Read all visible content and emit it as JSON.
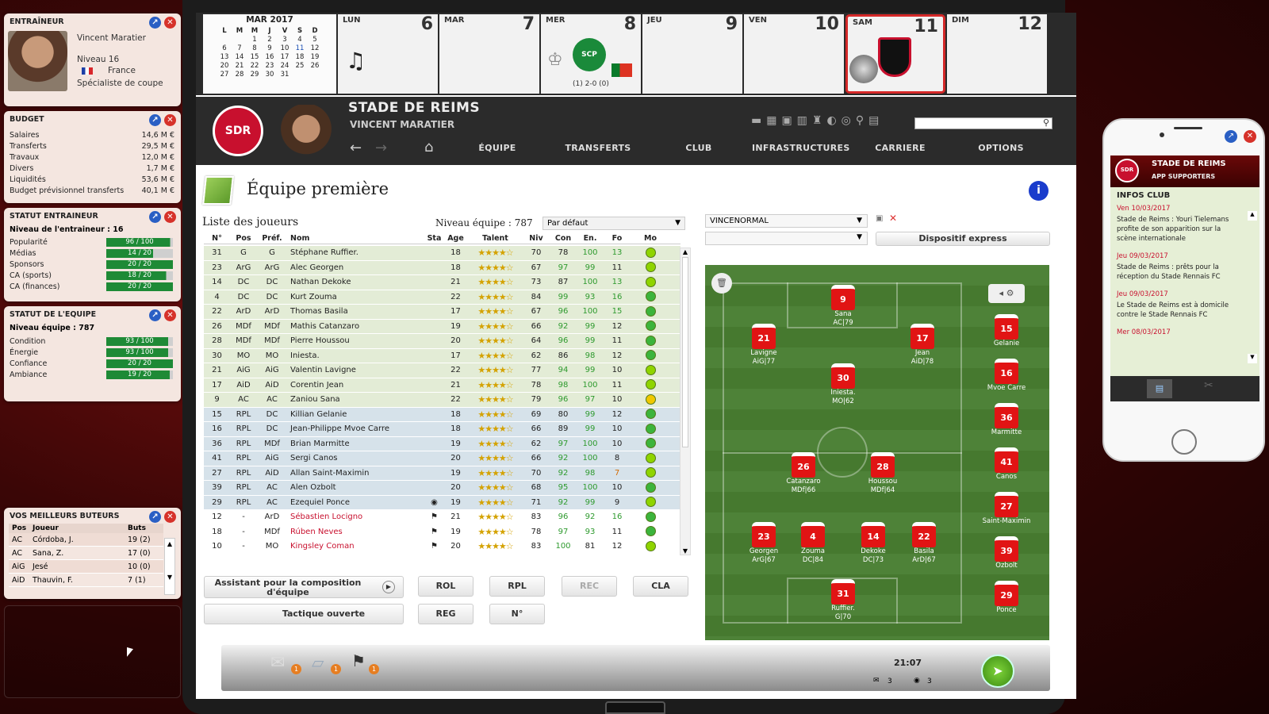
{
  "coach": {
    "title": "ENTRAÎNEUR",
    "name": "Vincent Maratier",
    "level": "Niveau 16",
    "country": "France",
    "spec": "Spécialiste de coupe"
  },
  "budget": {
    "title": "BUDGET",
    "rows": [
      {
        "k": "Salaires",
        "v": "14,6 M €"
      },
      {
        "k": "Transferts",
        "v": "29,5 M €"
      },
      {
        "k": "Travaux",
        "v": "12,0 M €"
      },
      {
        "k": "Divers",
        "v": "1,7 M €"
      },
      {
        "k": "Liquidités",
        "v": "53,6 M €"
      },
      {
        "k": "Budget prévisionnel transferts",
        "v": "40,1 M €"
      }
    ]
  },
  "coach_status": {
    "title": "STATUT ENTRAINEUR",
    "level": "Niveau de l'entraineur : 16",
    "rows": [
      {
        "k": "Popularité",
        "v": "96 / 100",
        "f": 0.96
      },
      {
        "k": "Médias",
        "v": "14 / 20",
        "f": 0.7
      },
      {
        "k": "Sponsors",
        "v": "20 / 20",
        "f": 1
      },
      {
        "k": "CA (sports)",
        "v": "18 / 20",
        "f": 0.9
      },
      {
        "k": "CA (finances)",
        "v": "20 / 20",
        "f": 1
      }
    ]
  },
  "team_status": {
    "title": "STATUT DE L'EQUIPE",
    "level": "Niveau équipe : 787",
    "rows": [
      {
        "k": "Condition",
        "v": "93 / 100",
        "f": 0.93
      },
      {
        "k": "Énergie",
        "v": "93 / 100",
        "f": 0.93
      },
      {
        "k": "Confiance",
        "v": "20 / 20",
        "f": 1
      },
      {
        "k": "Ambiance",
        "v": "19 / 20",
        "f": 0.95
      }
    ]
  },
  "scorers": {
    "title": "VOS MEILLEURS BUTEURS",
    "h_pos": "Pos",
    "h_player": "Joueur",
    "h_goals": "Buts",
    "rows": [
      {
        "p": "AC",
        "n": "Córdoba, J.",
        "g": "19 (2)"
      },
      {
        "p": "AC",
        "n": "Sana, Z.",
        "g": "17 (0)"
      },
      {
        "p": "AiG",
        "n": "Jesé",
        "g": "10 (0)"
      },
      {
        "p": "AiD",
        "n": "Thauvin, F.",
        "g": "7 (1)"
      }
    ]
  },
  "calendar": {
    "month": "MAR 2017",
    "dow": [
      "L",
      "M",
      "M",
      "J",
      "V",
      "S",
      "D"
    ],
    "weeks": [
      [
        "",
        "",
        "1",
        "2",
        "3",
        "4",
        "5"
      ],
      [
        "6",
        "7",
        "8",
        "9",
        "10",
        "11",
        "12"
      ],
      [
        "13",
        "14",
        "15",
        "16",
        "17",
        "18",
        "19"
      ],
      [
        "20",
        "21",
        "22",
        "23",
        "24",
        "25",
        "26"
      ],
      [
        "27",
        "28",
        "29",
        "30",
        "31",
        "",
        ""
      ]
    ],
    "days": [
      {
        "n": "LUN",
        "d": "6"
      },
      {
        "n": "MAR",
        "d": "7"
      },
      {
        "n": "MER",
        "d": "8"
      },
      {
        "n": "JEU",
        "d": "9"
      },
      {
        "n": "VEN",
        "d": "10"
      },
      {
        "n": "SAM",
        "d": "11"
      },
      {
        "n": "DIM",
        "d": "12"
      }
    ],
    "match_mer": "(1) 2-0 (0)",
    "scp": "SCP"
  },
  "header": {
    "club": "STADE DE REIMS",
    "coach": "VINCENT MARATIER",
    "crest": "SDR",
    "nav": [
      "ÉQUIPE",
      "TRANSFERTS",
      "CLUB",
      "INFRASTRUCTURES",
      "CARRIERE",
      "OPTIONS"
    ]
  },
  "page": {
    "title": "Équipe première",
    "list_title": "Liste des joueurs",
    "team_level": "Niveau équipe : 787",
    "sort": "Par défaut",
    "cols": [
      "N°",
      "Pos",
      "Préf.",
      "Nom",
      "Sta",
      "Age",
      "Talent",
      "Niv",
      "Con",
      "En.",
      "Fo",
      "Mo"
    ]
  },
  "players": [
    {
      "n": "31",
      "pos": "G",
      "pref": "G",
      "name": "Stéphane Ruffier.",
      "age": "18",
      "t": "★★★★☆",
      "niv": "70",
      "con": "78",
      "en": "100",
      "fo": "13",
      "c": "g",
      "mo": "#8fd400"
    },
    {
      "n": "23",
      "pos": "ArG",
      "pref": "ArG",
      "name": "Alec Georgen",
      "age": "18",
      "t": "★★★★☆",
      "niv": "67",
      "con": "97",
      "en": "99",
      "fo": "11",
      "c": "g",
      "mo": "#8fd400"
    },
    {
      "n": "14",
      "pos": "DC",
      "pref": "DC",
      "name": "Nathan Dekoke",
      "age": "21",
      "t": "★★★★☆",
      "niv": "73",
      "con": "87",
      "en": "100",
      "fo": "13",
      "c": "g",
      "mo": "#8fd400"
    },
    {
      "n": "4",
      "pos": "DC",
      "pref": "DC",
      "name": "Kurt Zouma",
      "age": "22",
      "t": "★★★★☆",
      "niv": "84",
      "con": "99",
      "en": "93",
      "fo": "16",
      "c": "g",
      "mo": "#3cb43c"
    },
    {
      "n": "22",
      "pos": "ArD",
      "pref": "ArD",
      "name": "Thomas Basila",
      "age": "17",
      "t": "★★★★☆",
      "niv": "67",
      "con": "96",
      "en": "100",
      "fo": "15",
      "c": "g",
      "mo": "#3cb43c"
    },
    {
      "n": "26",
      "pos": "MDf",
      "pref": "MDf",
      "name": "Mathis Catanzaro",
      "age": "19",
      "t": "★★★★☆",
      "niv": "66",
      "con": "92",
      "en": "99",
      "fo": "12",
      "c": "g",
      "mo": "#3cb43c"
    },
    {
      "n": "28",
      "pos": "MDf",
      "pref": "MDf",
      "name": "Pierre Houssou",
      "age": "20",
      "t": "★★★★☆",
      "niv": "64",
      "con": "96",
      "en": "99",
      "fo": "11",
      "c": "g",
      "mo": "#3cb43c"
    },
    {
      "n": "30",
      "pos": "MO",
      "pref": "MO",
      "name": "Iniesta.",
      "age": "17",
      "t": "★★★★☆",
      "niv": "62",
      "con": "86",
      "en": "98",
      "fo": "12",
      "c": "g",
      "mo": "#3cb43c"
    },
    {
      "n": "21",
      "pos": "AiG",
      "pref": "AiG",
      "name": "Valentin Lavigne",
      "age": "22",
      "t": "★★★★☆",
      "niv": "77",
      "con": "94",
      "en": "99",
      "fo": "10",
      "c": "g",
      "mo": "#8fd400"
    },
    {
      "n": "17",
      "pos": "AiD",
      "pref": "AiD",
      "name": "Corentin Jean",
      "age": "21",
      "t": "★★★★☆",
      "niv": "78",
      "con": "98",
      "en": "100",
      "fo": "11",
      "c": "g",
      "mo": "#8fd400"
    },
    {
      "n": "9",
      "pos": "AC",
      "pref": "AC",
      "name": "Zaniou Sana",
      "age": "22",
      "t": "★★★★☆",
      "niv": "79",
      "con": "96",
      "en": "97",
      "fo": "10",
      "c": "g",
      "mo": "#f0c800"
    },
    {
      "n": "15",
      "pos": "RPL",
      "pref": "DC",
      "name": "Killian Gelanie",
      "age": "18",
      "t": "★★★★☆",
      "niv": "69",
      "con": "80",
      "en": "99",
      "fo": "12",
      "c": "b",
      "mo": "#3cb43c"
    },
    {
      "n": "16",
      "pos": "RPL",
      "pref": "DC",
      "name": "Jean-Philippe Mvoe Carre",
      "age": "18",
      "t": "★★★★☆",
      "niv": "66",
      "con": "89",
      "en": "99",
      "fo": "10",
      "c": "b",
      "mo": "#3cb43c"
    },
    {
      "n": "36",
      "pos": "RPL",
      "pref": "MDf",
      "name": "Brian Marmitte",
      "age": "19",
      "t": "★★★★☆",
      "niv": "62",
      "con": "97",
      "en": "100",
      "fo": "10",
      "c": "b",
      "mo": "#3cb43c"
    },
    {
      "n": "41",
      "pos": "RPL",
      "pref": "AiG",
      "name": "Sergi Canos",
      "age": "20",
      "t": "★★★★☆",
      "niv": "66",
      "con": "92",
      "en": "100",
      "fo": "8",
      "c": "b",
      "mo": "#8fd400"
    },
    {
      "n": "27",
      "pos": "RPL",
      "pref": "AiD",
      "name": "Allan Saint-Maximin",
      "age": "19",
      "t": "★★★★☆",
      "niv": "70",
      "con": "92",
      "en": "98",
      "fo": "7",
      "c": "b",
      "mo": "#8fd400"
    },
    {
      "n": "39",
      "pos": "RPL",
      "pref": "AC",
      "name": "Alen Ozbolt",
      "age": "20",
      "t": "★★★★☆",
      "niv": "68",
      "con": "95",
      "en": "100",
      "fo": "10",
      "c": "b",
      "mo": "#3cb43c"
    },
    {
      "n": "29",
      "pos": "RPL",
      "pref": "AC",
      "name": "Ezequiel Ponce",
      "age": "19",
      "t": "★★★★☆",
      "niv": "71",
      "con": "92",
      "en": "99",
      "fo": "9",
      "c": "b",
      "mo": "#8fd400"
    },
    {
      "n": "12",
      "pos": "-",
      "pref": "ArD",
      "name": "Sébastien Locigno",
      "age": "21",
      "t": "★★★★☆",
      "niv": "83",
      "con": "96",
      "en": "92",
      "fo": "16",
      "c": "w",
      "mo": "#3cb43c"
    },
    {
      "n": "18",
      "pos": "-",
      "pref": "MDf",
      "name": "Rúben Neves",
      "age": "19",
      "t": "★★★★☆",
      "niv": "78",
      "con": "97",
      "en": "93",
      "fo": "11",
      "c": "w",
      "mo": "#3cb43c"
    },
    {
      "n": "10",
      "pos": "-",
      "pref": "MO",
      "name": "Kingsley Coman",
      "age": "20",
      "t": "★★★★☆",
      "niv": "83",
      "con": "100",
      "en": "81",
      "fo": "12",
      "c": "w",
      "mo": "#8fd400"
    }
  ],
  "buttons": {
    "assistant": "Assistant pour la composition d'équipe",
    "tactic": "Tactique ouverte",
    "rol": "ROL",
    "rpl": "RPL",
    "rec": "REC",
    "cla": "CLA",
    "reg": "REG",
    "num": "N°"
  },
  "tactics": {
    "formation": "VINCENORMAL",
    "express": "Dispositif express"
  },
  "pitch": [
    {
      "n": "9",
      "name": "Sana",
      "role": "AC|79"
    },
    {
      "n": "21",
      "name": "Lavigne",
      "role": "AiG|77"
    },
    {
      "n": "17",
      "name": "Jean",
      "role": "AiD|78"
    },
    {
      "n": "30",
      "name": "Iniesta.",
      "role": "MO|62"
    },
    {
      "n": "26",
      "name": "Catanzaro",
      "role": "MDf|66"
    },
    {
      "n": "28",
      "name": "Houssou",
      "role": "MDf|64"
    },
    {
      "n": "23",
      "name": "Georgen",
      "role": "ArG|67"
    },
    {
      "n": "4",
      "name": "Zouma",
      "role": "DC|84"
    },
    {
      "n": "14",
      "name": "Dekoke",
      "role": "DC|73"
    },
    {
      "n": "22",
      "name": "Basila",
      "role": "ArD|67"
    },
    {
      "n": "31",
      "name": "Ruffier.",
      "role": "G|70"
    }
  ],
  "bench": [
    {
      "n": "15",
      "name": "Gelanie"
    },
    {
      "n": "16",
      "name": "Mvoe Carre"
    },
    {
      "n": "36",
      "name": "Marmitte"
    },
    {
      "n": "41",
      "name": "Canos"
    },
    {
      "n": "27",
      "name": "Saint-Maximin"
    },
    {
      "n": "39",
      "name": "Ozbolt"
    },
    {
      "n": "29",
      "name": "Ponce"
    }
  ],
  "phone": {
    "club": "STADE DE REIMS",
    "app": "APP SUPPORTERS",
    "section": "INFOS CLUB",
    "news": [
      {
        "d": "Ven 10/03/2017",
        "t": "Stade de Reims : Youri Tielemans profite de son apparition sur la scène internationale"
      },
      {
        "d": "Jeu 09/03/2017",
        "t": "Stade de Reims : prêts pour la réception du Stade Rennais FC"
      },
      {
        "d": "Jeu 09/03/2017",
        "t": "Le Stade de Reims est à domicile contre le Stade Rennais FC"
      },
      {
        "d": "Mer 08/03/2017",
        "t": ""
      }
    ]
  },
  "status": {
    "time": "21:07",
    "mail": "3",
    "msgs": "3",
    "badge": "1"
  },
  "colors": {
    "accent": "#c8102e",
    "bar": "#1e8a36",
    "link": "#1a4fb4"
  }
}
